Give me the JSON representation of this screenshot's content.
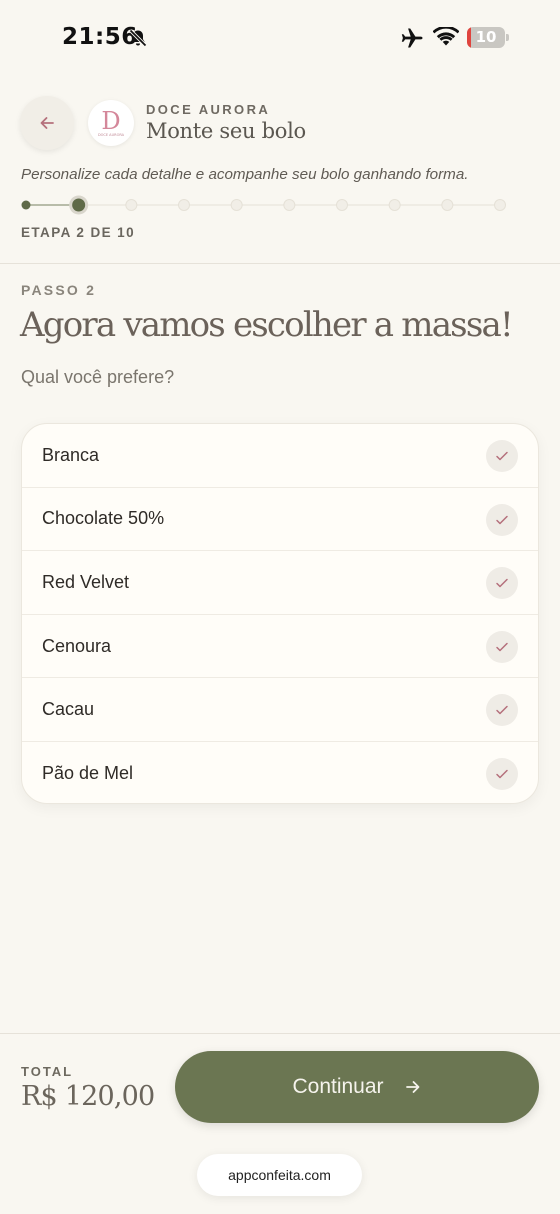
{
  "status_bar": {
    "time": "21:56",
    "battery": "10",
    "icons": [
      "bell-slash-icon",
      "airplane-icon",
      "wifi-icon",
      "battery-icon"
    ]
  },
  "header": {
    "back_icon": "arrow-left-icon",
    "brand": "DOCE AURORA",
    "logo_letter": "D",
    "logo_caption": "DOCE AURORA",
    "title": "Monte seu bolo",
    "subtitle": "Personalize cada detalhe e acompanhe seu bolo ganhando forma."
  },
  "progress": {
    "current_step": 2,
    "total_steps": 10,
    "label": "ETAPA 2 DE 10"
  },
  "step": {
    "label": "PASSO 2",
    "headline": "Agora vamos escolher a massa!",
    "question": "Qual você prefere?",
    "options": [
      {
        "label": "Branca"
      },
      {
        "label": "Chocolate 50%"
      },
      {
        "label": "Red Velvet"
      },
      {
        "label": "Cenoura"
      },
      {
        "label": "Cacau"
      },
      {
        "label": "Pão de Mel"
      }
    ]
  },
  "footer": {
    "total_label": "TOTAL",
    "total_value": "R$ 120,00",
    "continue_label": "Continuar",
    "url": "appconfeita.com"
  },
  "colors": {
    "background": "#f9f7f1",
    "primary": "#6b7652",
    "check": "#b5707c"
  }
}
